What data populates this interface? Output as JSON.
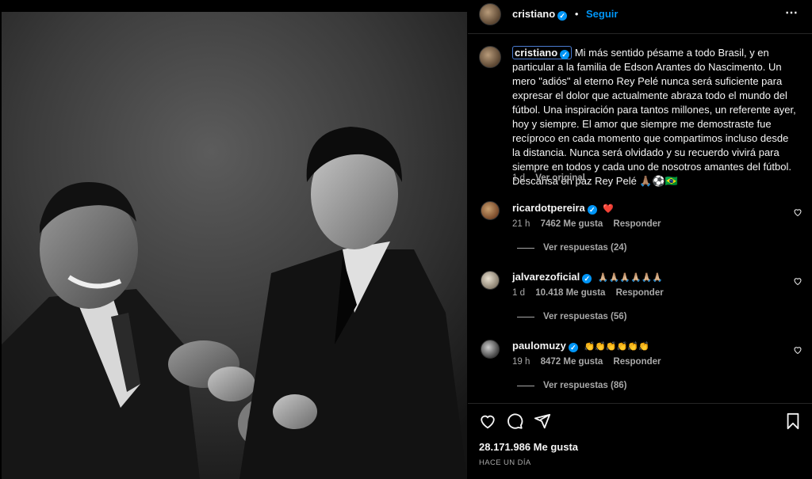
{
  "post": {
    "author": "cristiano",
    "follow_label": "Seguir",
    "dot": "•",
    "more_icon": "⋯",
    "caption_user": "cristiano",
    "caption_text": "Mi más sentido pésame a todo Brasil, y en particular a la familia de Edson Arantes do Nascimento. Un mero \"adiós\" al eterno Rey Pelé nunca será suficiente para expresar el dolor que actualmente abraza todo el mundo del fútbol. Una inspiración para tantos millones, un referente ayer, hoy y siempre. El amor que siempre me demostraste fue recíproco en cada momento que compartimos incluso desde la distancia. Nunca será olvidado y su recuerdo vivirá para siempre en todos y cada uno de nosotros amantes del fútbol. Descansa en paz Rey Pelé 🙏🏽⚽🇧🇷",
    "caption_time": "1 d",
    "see_translation": "Ver original"
  },
  "comments": [
    {
      "user": "ricardotpereira",
      "text": "❤️",
      "time": "21 h",
      "likes": "7462 Me gusta",
      "reply": "Responder",
      "view_replies": "Ver respuestas (24)"
    },
    {
      "user": "jalvarezoficial",
      "text": "🙏🏼🙏🏼🙏🏼🙏🏼🙏🏼🙏🏼",
      "time": "1 d",
      "likes": "10.418 Me gusta",
      "reply": "Responder",
      "view_replies": "Ver respuestas (56)"
    },
    {
      "user": "paulomuzy",
      "text": "👏👏👏👏👏👏",
      "time": "19 h",
      "likes": "8472 Me gusta",
      "reply": "Responder",
      "view_replies": "Ver respuestas (86)"
    }
  ],
  "footer": {
    "likes_count": "28.171.986 Me gusta",
    "posted_ago": "HACE UN DÍA"
  },
  "icons": {
    "like": "heart-icon",
    "comment": "comment-icon",
    "share": "share-icon",
    "save": "bookmark-icon",
    "verified": "verified-badge-icon"
  },
  "colors": {
    "background": "#000000",
    "text": "#f5f5f5",
    "muted": "#a8a8a8",
    "accent": "#0095f6",
    "divider": "#262626"
  }
}
